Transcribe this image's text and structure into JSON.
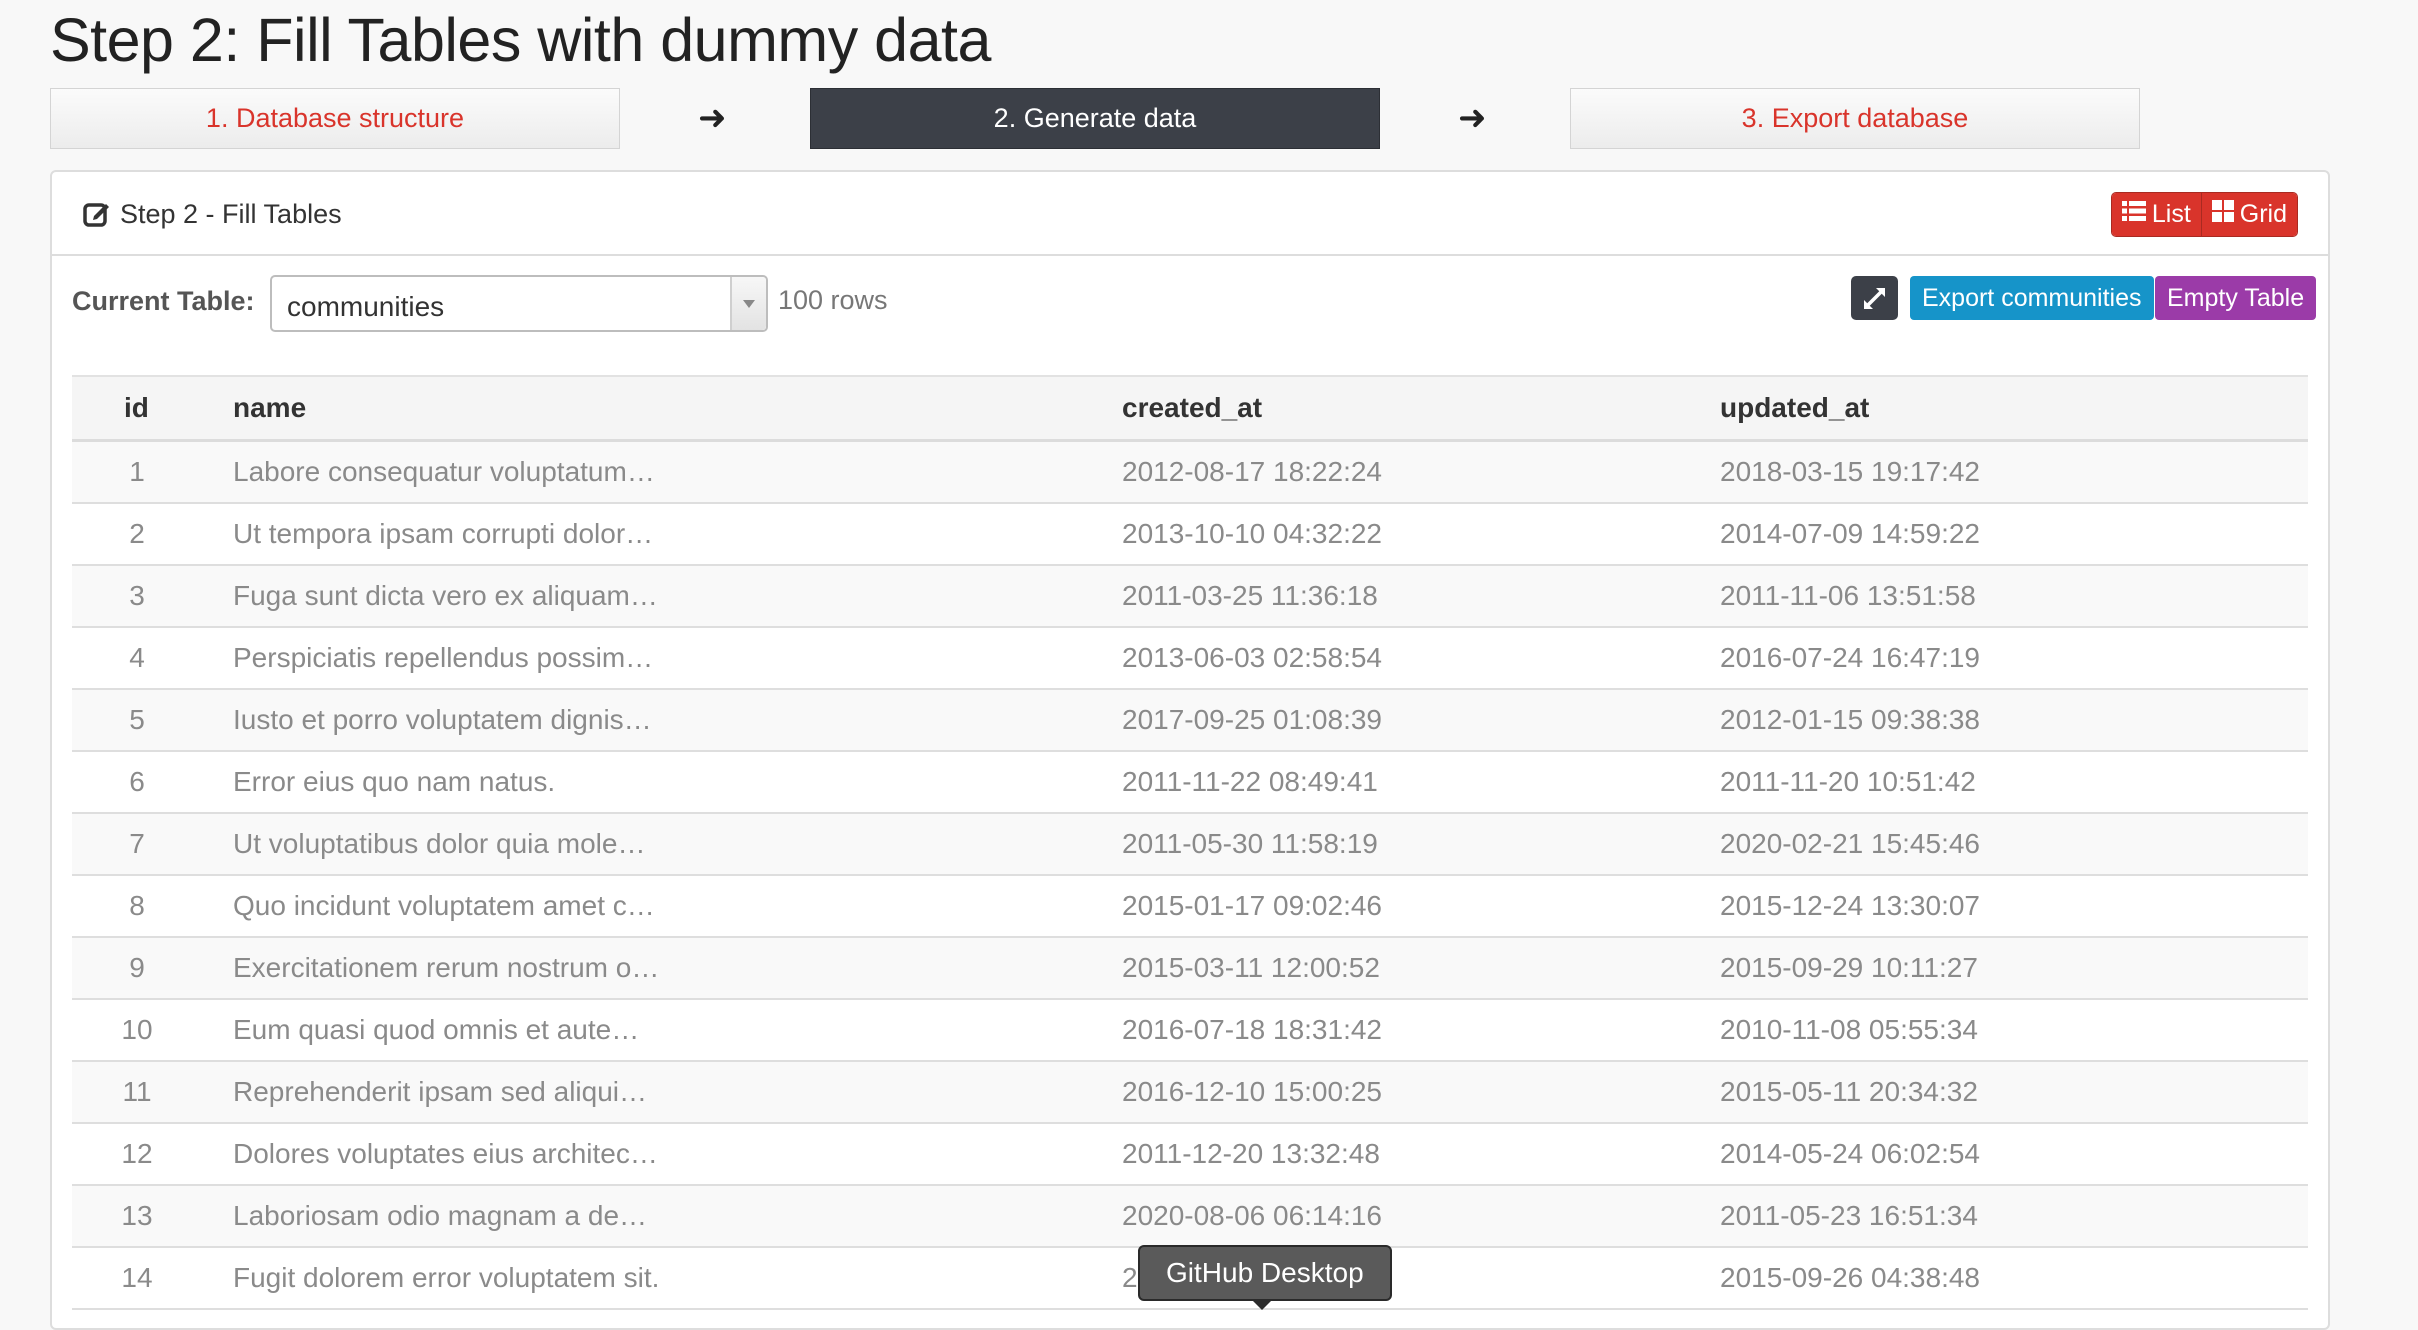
{
  "page": {
    "title": "Step 2: Fill Tables with dummy data"
  },
  "steps": [
    {
      "label": "1. Database structure",
      "active": false
    },
    {
      "label": "2. Generate data",
      "active": true
    },
    {
      "label": "3. Export database",
      "active": false
    }
  ],
  "panel": {
    "heading": "Step 2 - Fill Tables",
    "view_toggle": {
      "list_label": "List",
      "grid_label": "Grid"
    }
  },
  "toolbar": {
    "current_table_label": "Current Table:",
    "selected_table": "communities",
    "row_count": "100 rows",
    "export_label": "Export communities",
    "empty_label": "Empty Table"
  },
  "table": {
    "columns": [
      "id",
      "name",
      "created_at",
      "updated_at"
    ],
    "rows": [
      [
        "1",
        "Labore consequatur voluptatum…",
        "2012-08-17 18:22:24",
        "2018-03-15 19:17:42"
      ],
      [
        "2",
        "Ut tempora ipsam corrupti dolor…",
        "2013-10-10 04:32:22",
        "2014-07-09 14:59:22"
      ],
      [
        "3",
        "Fuga sunt dicta vero ex aliquam…",
        "2011-03-25 11:36:18",
        "2011-11-06 13:51:58"
      ],
      [
        "4",
        "Perspiciatis repellendus possim…",
        "2013-06-03 02:58:54",
        "2016-07-24 16:47:19"
      ],
      [
        "5",
        "Iusto et porro voluptatem dignis…",
        "2017-09-25 01:08:39",
        "2012-01-15 09:38:38"
      ],
      [
        "6",
        "Error eius quo nam natus.",
        "2011-11-22 08:49:41",
        "2011-11-20 10:51:42"
      ],
      [
        "7",
        "Ut voluptatibus dolor quia mole…",
        "2011-05-30 11:58:19",
        "2020-02-21 15:45:46"
      ],
      [
        "8",
        "Quo incidunt voluptatem amet c…",
        "2015-01-17 09:02:46",
        "2015-12-24 13:30:07"
      ],
      [
        "9",
        "Exercitationem rerum nostrum o…",
        "2015-03-11 12:00:52",
        "2015-09-29 10:11:27"
      ],
      [
        "10",
        "Eum quasi quod omnis et aute…",
        "2016-07-18 18:31:42",
        "2010-11-08 05:55:34"
      ],
      [
        "11",
        "Reprehenderit ipsam sed aliqui…",
        "2016-12-10 15:00:25",
        "2015-05-11 20:34:32"
      ],
      [
        "12",
        "Dolores voluptates eius architec…",
        "2011-12-20 13:32:48",
        "2014-05-24 06:02:54"
      ],
      [
        "13",
        "Laboriosam odio magnam a de…",
        "2020-08-06 06:14:16",
        "2011-05-23 16:51:34"
      ],
      [
        "14",
        "Fugit dolorem error voluptatem sit.",
        "2",
        "2015-09-26 04:38:48"
      ]
    ]
  },
  "tooltip": {
    "text": "GitHub Desktop"
  },
  "colors": {
    "accent_red": "#d9342b",
    "dark": "#3c4048",
    "info": "#1694c9",
    "purple": "#9b3ba8"
  },
  "icons": [
    "edit-icon",
    "list-icon",
    "grid-icon",
    "expand-icon",
    "arrow-right-icon",
    "chevron-down-icon"
  ]
}
